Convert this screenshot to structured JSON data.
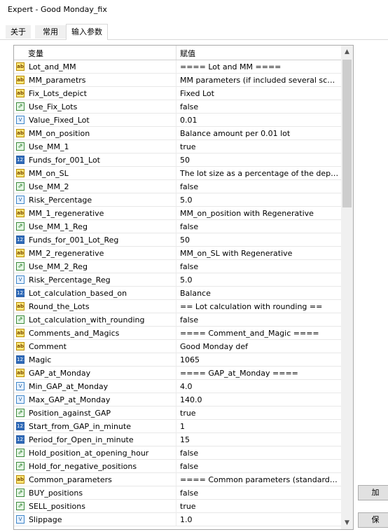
{
  "window": {
    "title": "Expert - Good Monday_fix"
  },
  "tabs": [
    {
      "label": "关于"
    },
    {
      "label": "常用"
    },
    {
      "label": "输入参数"
    }
  ],
  "grid": {
    "col_variable": "变量",
    "col_value": "赋值",
    "rows": [
      {
        "type": "ab",
        "icon": "string-type-icon",
        "name": "Lot_and_MM",
        "value": "==== Lot and MM ===="
      },
      {
        "type": "ab",
        "icon": "string-type-icon",
        "name": "MM_parametrs",
        "value": "MM parameters (if included several sche..."
      },
      {
        "type": "ab",
        "icon": "string-type-icon",
        "name": "Fix_Lots_depict",
        "value": "Fixed Lot"
      },
      {
        "type": "bool",
        "icon": "bool-type-icon",
        "name": "Use_Fix_Lots",
        "value": "false"
      },
      {
        "type": "dbl",
        "icon": "double-type-icon",
        "name": "Value_Fixed_Lot",
        "value": "0.01"
      },
      {
        "type": "ab",
        "icon": "string-type-icon",
        "name": "MM_on_position",
        "value": "Balance amount per 0.01 lot"
      },
      {
        "type": "bool",
        "icon": "bool-type-icon",
        "name": "Use_MM_1",
        "value": "true"
      },
      {
        "type": "int",
        "icon": "int-type-icon",
        "name": "Funds_for_001_Lot",
        "value": "50"
      },
      {
        "type": "ab",
        "icon": "string-type-icon",
        "name": "MM_on_SL",
        "value": "The lot size as a percentage of the depo..."
      },
      {
        "type": "bool",
        "icon": "bool-type-icon",
        "name": "Use_MM_2",
        "value": "false"
      },
      {
        "type": "dbl",
        "icon": "double-type-icon",
        "name": "Risk_Percentage",
        "value": "5.0"
      },
      {
        "type": "ab",
        "icon": "string-type-icon",
        "name": "MM_1_regenerative",
        "value": "MM_on_position with Regenerative"
      },
      {
        "type": "bool",
        "icon": "bool-type-icon",
        "name": "Use_MM_1_Reg",
        "value": "false"
      },
      {
        "type": "int",
        "icon": "int-type-icon",
        "name": "Funds_for_001_Lot_Reg",
        "value": "50"
      },
      {
        "type": "ab",
        "icon": "string-type-icon",
        "name": "MM_2_regenerative",
        "value": "MM_on_SL with Regenerative"
      },
      {
        "type": "bool",
        "icon": "bool-type-icon",
        "name": "Use_MM_2_Reg",
        "value": "false"
      },
      {
        "type": "dbl",
        "icon": "double-type-icon",
        "name": "Risk_Percentage_Reg",
        "value": "5.0"
      },
      {
        "type": "int",
        "icon": "int-type-icon",
        "name": "Lot_calculation_based_on",
        "value": "Balance"
      },
      {
        "type": "ab",
        "icon": "string-type-icon",
        "name": "Round_the_Lots",
        "value": "== Lot calculation with rounding =="
      },
      {
        "type": "bool",
        "icon": "bool-type-icon",
        "name": "Lot_calculation_with_rounding",
        "value": "false"
      },
      {
        "type": "ab",
        "icon": "string-type-icon",
        "name": "Comments_and_Magics",
        "value": "==== Comment_and_Magic ===="
      },
      {
        "type": "ab",
        "icon": "string-type-icon",
        "name": "Comment",
        "value": "Good Monday def"
      },
      {
        "type": "int",
        "icon": "int-type-icon",
        "name": "Magic",
        "value": "1065"
      },
      {
        "type": "ab",
        "icon": "string-type-icon",
        "name": "GAP_at_Monday",
        "value": "==== GAP_at_Monday ===="
      },
      {
        "type": "dbl",
        "icon": "double-type-icon",
        "name": "Min_GAP_at_Monday",
        "value": "4.0"
      },
      {
        "type": "dbl",
        "icon": "double-type-icon",
        "name": "Max_GAP_at_Monday",
        "value": "140.0"
      },
      {
        "type": "bool",
        "icon": "bool-type-icon",
        "name": "Position_against_GAP",
        "value": "true"
      },
      {
        "type": "int",
        "icon": "int-type-icon",
        "name": "Start_from_GAP_in_minute",
        "value": "1"
      },
      {
        "type": "int",
        "icon": "int-type-icon",
        "name": "Period_for_Open_in_minute",
        "value": "15"
      },
      {
        "type": "bool",
        "icon": "bool-type-icon",
        "name": "Hold_position_at_opening_hour",
        "value": "false"
      },
      {
        "type": "bool",
        "icon": "bool-type-icon",
        "name": "Hold_for_negative_positions",
        "value": "false"
      },
      {
        "type": "ab",
        "icon": "string-type-icon",
        "name": "Common_parameters",
        "value": "==== Common parameters (standard pi..."
      },
      {
        "type": "bool",
        "icon": "bool-type-icon",
        "name": "BUY_positions",
        "value": "false"
      },
      {
        "type": "bool",
        "icon": "bool-type-icon",
        "name": "SELL_positions",
        "value": "true"
      },
      {
        "type": "dbl",
        "icon": "double-type-icon",
        "name": "Slippage",
        "value": "1.0"
      }
    ]
  },
  "buttons": [
    {
      "label": "加"
    },
    {
      "label": "保"
    }
  ],
  "scroll": {
    "up": "▲",
    "down": "▼"
  }
}
